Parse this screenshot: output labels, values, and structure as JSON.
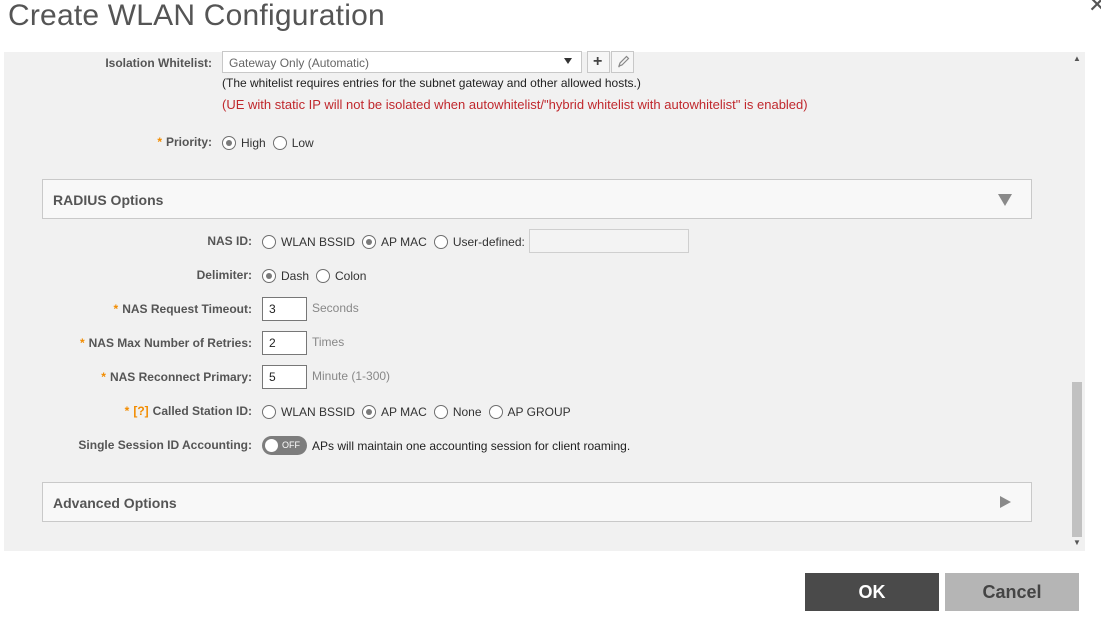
{
  "dialog": {
    "title": "Create WLAN Configuration",
    "close_icon": "close-icon"
  },
  "isolation": {
    "label": "Isolation Whitelist:",
    "selected": "Gateway Only (Automatic)",
    "add_icon": "plus-icon",
    "edit_icon": "pencil-icon",
    "note1": "(The whitelist requires entries for the subnet gateway and other allowed hosts.)",
    "note2": "(UE with static IP will not be isolated when autowhitelist/\"hybrid whitelist with autowhitelist\" is enabled)"
  },
  "priority": {
    "label": "Priority:",
    "required_mark": "*",
    "options": [
      "High",
      "Low"
    ],
    "selected": "High"
  },
  "radius": {
    "title": "RADIUS Options",
    "expanded": true,
    "nas_id": {
      "label": "NAS ID:",
      "options": [
        "WLAN BSSID",
        "AP MAC",
        "User-defined:"
      ],
      "selected": "AP MAC",
      "user_defined_value": ""
    },
    "delimiter": {
      "label": "Delimiter:",
      "options": [
        "Dash",
        "Colon"
      ],
      "selected": "Dash"
    },
    "nas_request_timeout": {
      "label": "NAS Request Timeout:",
      "required_mark": "*",
      "value": "3",
      "unit": "Seconds"
    },
    "nas_max_retries": {
      "label": "NAS Max Number of Retries:",
      "required_mark": "*",
      "value": "2",
      "unit": "Times"
    },
    "nas_reconnect_primary": {
      "label": "NAS Reconnect Primary:",
      "required_mark": "*",
      "value": "5",
      "unit": "Minute (1-300)"
    },
    "called_station_id": {
      "label": "Called Station ID:",
      "required_mark": "*",
      "help_link": "[?]",
      "options": [
        "WLAN BSSID",
        "AP MAC",
        "None",
        "AP GROUP"
      ],
      "selected": "AP MAC"
    },
    "single_session": {
      "label": "Single Session ID Accounting:",
      "toggle_state": "OFF",
      "description": "APs will maintain one accounting session for client roaming."
    }
  },
  "advanced": {
    "title": "Advanced Options",
    "expanded": false
  },
  "footer": {
    "ok_label": "OK",
    "cancel_label": "Cancel"
  },
  "colors": {
    "required": "#f28c00",
    "warning": "#c0282d",
    "ok_button": "#4a4a4a",
    "cancel_button": "#b5b5b5",
    "panel_background": "#f1f1f1"
  }
}
